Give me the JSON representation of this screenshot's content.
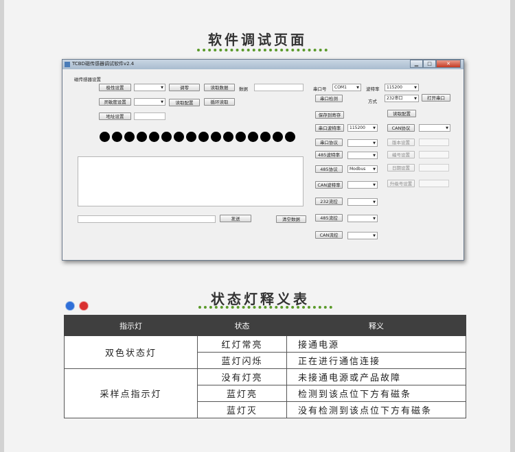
{
  "titles": {
    "software_page": "软件调试页面",
    "status_table": "状态灯释义表"
  },
  "window": {
    "title": "TCBD磁传感器调试软件v2.4",
    "controls": {
      "minimize": "▁",
      "maximize": "□",
      "close": "✕"
    }
  },
  "sensor": {
    "group_label": "磁传感器设置",
    "polarity_btn": "极性设置",
    "sensitivity_btn": "灵敏度设置",
    "address_btn": "地址设置",
    "zero_btn": "调零",
    "read_data_btn": "读取数据",
    "read_config_btn": "读取配置",
    "loop_read_btn": "循环读取",
    "data_label": "数据",
    "send_btn": "发送",
    "clear_btn": "清空数据",
    "led_count": 16
  },
  "serial": {
    "port_label": "串口号",
    "port_value": "COM1",
    "baud_label": "波特率",
    "baud_value": "115200",
    "mode_label": "方式",
    "mode_value": "232串口",
    "open_btn": "打开串口",
    "detect_btn": "串口检测",
    "save_btn": "保存到寄存",
    "read_config_btn": "读取配置",
    "uart_baud_btn": "串口波特率",
    "uart_baud_value": "115200",
    "can_protocol_btn": "CAN协议",
    "uart_protocol_btn": "串口协议",
    "version_btn": "版本设置",
    "rs485_baud_btn": "485波特率",
    "serial_no_btn": "编号设置",
    "rs485_protocol_btn": "485协议",
    "rs485_protocol_value": "Modbus",
    "date_btn": "日期设置",
    "can_baud_btn": "CAN波特率",
    "upgrade_btn": "升级号设置",
    "flow232_btn": "232流控",
    "flow485_btn": "485流控",
    "can_flow_btn": "CAN流控"
  },
  "legend": {
    "headers": [
      "指示灯",
      "状态",
      "释义"
    ],
    "groups": [
      {
        "name": "双色状态灯",
        "rows": [
          {
            "state": "红灯常亮",
            "meaning": "接通电源"
          },
          {
            "state": "蓝灯闪烁",
            "meaning": "正在进行通信连接"
          }
        ]
      },
      {
        "name": "采样点指示灯",
        "rows": [
          {
            "state": "没有灯亮",
            "meaning": "未接通电源或产品故障"
          },
          {
            "state": "蓝灯亮",
            "meaning": "检测到该点位下方有磁条"
          },
          {
            "state": "蓝灯灭",
            "meaning": "没有检测到该点位下方有磁条"
          }
        ]
      }
    ]
  },
  "colors": {
    "blue_dot": "#2f6fd8",
    "red_dot": "#d93030",
    "title_dots": "#5a9a2a"
  }
}
